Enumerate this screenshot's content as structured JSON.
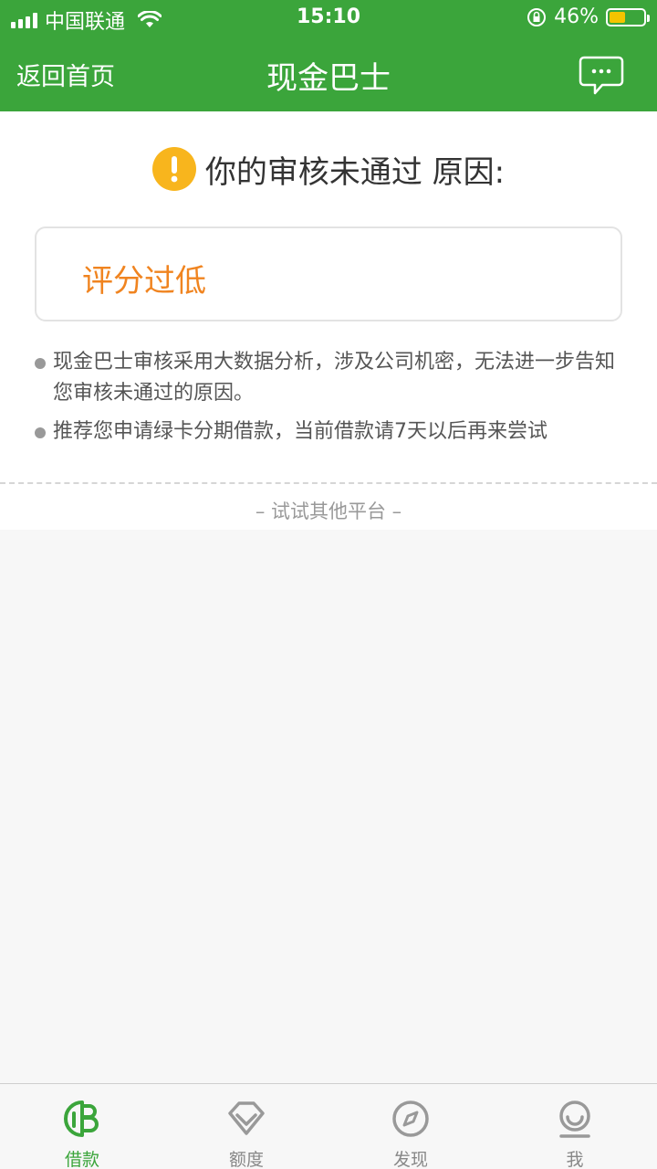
{
  "status_bar": {
    "carrier": "中国联通",
    "time": "15:10",
    "battery_percent": "46%",
    "battery_level": 0.46
  },
  "header": {
    "back_label": "返回首页",
    "title": "现金巴士"
  },
  "audit": {
    "heading": "你的审核未通过 原因:",
    "reason": "评分过低",
    "notes": [
      "现金巴士审核采用大数据分析，涉及公司机密，无法进一步告知您审核未通过的原因。",
      "推荐您申请绿卡分期借款，当前借款请7天以后再来尝试"
    ],
    "other_platforms": "– 试试其他平台 –"
  },
  "tabs": [
    {
      "label": "借款",
      "icon": "loan-icon",
      "active": true
    },
    {
      "label": "额度",
      "icon": "diamond-icon",
      "active": false
    },
    {
      "label": "发现",
      "icon": "compass-icon",
      "active": false
    },
    {
      "label": "我",
      "icon": "profile-icon",
      "active": false
    }
  ],
  "colors": {
    "brand_green": "#3ba53b",
    "warning_orange": "#f08420",
    "warning_icon": "#f8b51d",
    "battery_yellow": "#f5c400"
  }
}
